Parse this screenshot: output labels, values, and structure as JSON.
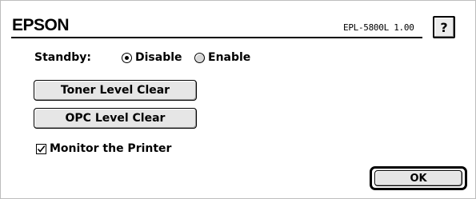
{
  "header": {
    "brand": "EPSON",
    "model": "EPL-5800L 1.00",
    "help_label": "?"
  },
  "standby": {
    "label": "Standby:",
    "options": [
      {
        "label": "Disable",
        "selected": true
      },
      {
        "label": "Enable",
        "selected": false
      }
    ]
  },
  "buttons": {
    "toner_level_clear": "Toner Level Clear",
    "opc_level_clear": "OPC Level Clear",
    "ok": "OK"
  },
  "monitor": {
    "label": "Monitor the Printer",
    "checked": true
  },
  "icons": {
    "help": "question-mark-icon",
    "check": "checkmark-icon"
  }
}
